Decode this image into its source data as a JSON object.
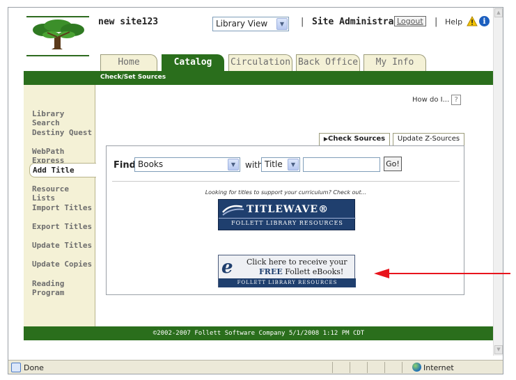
{
  "header": {
    "site_name": "new site123",
    "view_select": "Library View",
    "user": "Site Administrator",
    "logout": "Logout",
    "help": "Help",
    "separator": "|"
  },
  "tabs": [
    {
      "label": "Home"
    },
    {
      "label": "Catalog",
      "active": true
    },
    {
      "label": "Circulation"
    },
    {
      "label": "Back Office"
    },
    {
      "label": "My Info"
    }
  ],
  "subheader": "Check/Set Sources",
  "sidebar": {
    "items": [
      {
        "label": "Library Search"
      },
      {
        "label": "Destiny Quest"
      },
      {
        "label": "WebPath Express"
      },
      {
        "label": "Add Title",
        "active": true
      },
      {
        "label": "Resource Lists"
      },
      {
        "label": "Import Titles"
      },
      {
        "label": "Export Titles"
      },
      {
        "label": "Update Titles"
      },
      {
        "label": "Update Copies"
      },
      {
        "label": "Reading Program"
      }
    ]
  },
  "main": {
    "how_do_i": "How do I...",
    "help_q": "?",
    "source_tabs": [
      {
        "label": "Check Sources",
        "active": true
      },
      {
        "label": "Update Z-Sources"
      }
    ],
    "find": {
      "label": "Find",
      "type_select": "Books",
      "with_label": "with",
      "field_select": "Title",
      "query": "",
      "go": "Go!"
    },
    "looking_text": "Looking for titles to support your curriculum? Check out...",
    "titlewave": {
      "main": "TITLEWAVE®",
      "sub": "FOLLETT LIBRARY RESOURCES"
    },
    "ebooks": {
      "line1": "Click here to receive your",
      "line2_bold": "FREE",
      "line2_rest": " Follett eBooks!",
      "footer": "FOLLETT LIBRARY RESOURCES"
    }
  },
  "footer": {
    "text": "©2002-2007  Follett Software Company    5/1/2008 1:12 PM CDT"
  },
  "status_bar": {
    "status": "Done",
    "zone": "Internet"
  },
  "colors": {
    "brand_green": "#2a6e1c",
    "sidebar_bg": "#f4f1d6",
    "arrow": "#e8141c"
  }
}
